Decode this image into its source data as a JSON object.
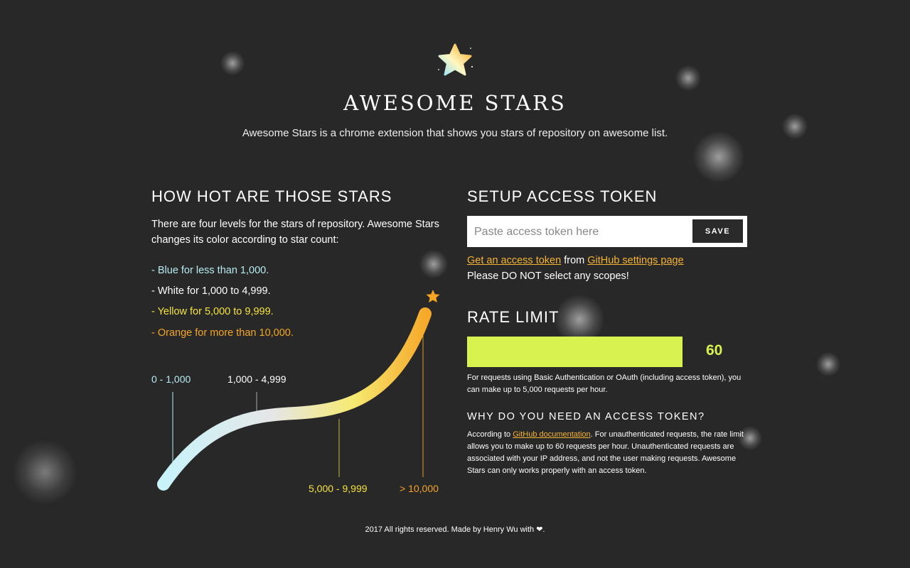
{
  "header": {
    "title": "AWESOME STARS",
    "subtitle": "Awesome Stars is a chrome extension that shows you stars of repository on awesome list."
  },
  "hot": {
    "heading": "HOW HOT ARE THOSE STARS",
    "intro": "There are four levels for the stars of repository. Awesome Stars changes its color according to star count:",
    "levels": [
      {
        "text": "- Blue for less than 1,000.",
        "color": "#b6ecf2"
      },
      {
        "text": "- White for 1,000 to 4,999.",
        "color": "#ffffff"
      },
      {
        "text": "- Yellow for 5,000 to 9,999.",
        "color": "#f5e33c"
      },
      {
        "text": "- Orange for more than 10,000.",
        "color": "#f5a523"
      }
    ],
    "curve_labels": [
      "0 - 1,000",
      "1,000 - 4,999",
      "5,000 - 9,999",
      "> 10,000"
    ]
  },
  "token": {
    "heading": "SETUP ACCESS TOKEN",
    "placeholder": "Paste access token here",
    "value": "",
    "save_label": "SAVE",
    "link1": "Get an access token",
    "from_text": " from ",
    "link2": "GitHub settings page",
    "warning": "Please DO NOT select any scopes!"
  },
  "rate": {
    "heading": "RATE LIMIT",
    "value": "60",
    "bar_fill_fraction": 1.0,
    "bar_color": "#d8f34f",
    "note": "For requests using Basic Authentication or OAuth (including access token), you can make up to 5,000 requests per hour."
  },
  "why": {
    "heading": "WHY DO YOU NEED AN ACCESS TOKEN?",
    "prefix": "According to ",
    "link": "GitHub documentation",
    "text": ". For unauthenticated requests, the rate limit allows you to make up to 60 requests per hour. Unauthenticated requests are associated with your IP address, and not the user making requests. Awesome Stars can only works properly with an access token."
  },
  "footer": {
    "text": "2017 All rights reserved. Made by Henry Wu with",
    "heart": "❤",
    "end": "."
  },
  "colors": {
    "background": "#282828",
    "accent": "#f5b431",
    "blue": "#b6ecf2",
    "yellow": "#f5e33c",
    "orange": "#f5a523"
  }
}
